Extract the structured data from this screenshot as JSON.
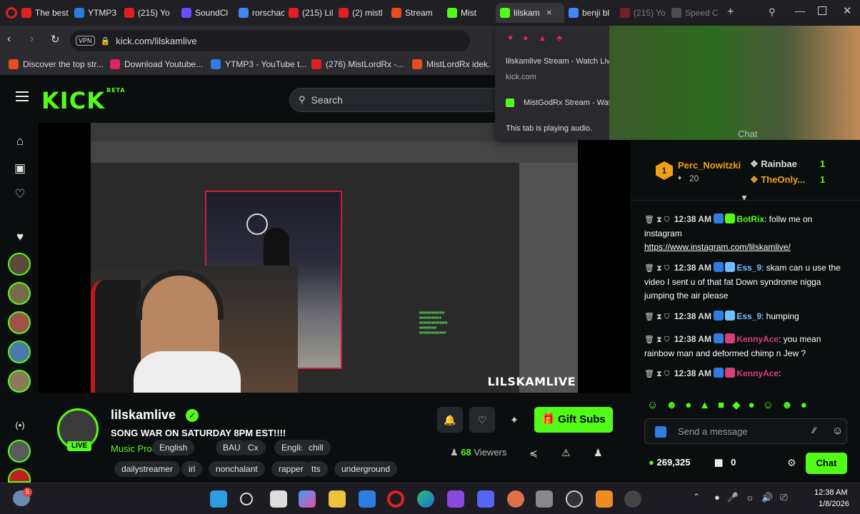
{
  "browser": {
    "tabs": [
      {
        "label": "The best",
        "color": "#e02020"
      },
      {
        "label": "YTMP3",
        "color": "#2f7de1"
      },
      {
        "label": "(215) Yo",
        "color": "#e02020"
      },
      {
        "label": "SoundCl",
        "color": "#6a4bff"
      },
      {
        "label": "rorschac",
        "color": "#4285f4"
      },
      {
        "label": "(215) Lil",
        "color": "#e02020"
      },
      {
        "label": "(2) mistl",
        "color": "#e02020"
      },
      {
        "label": "Stream",
        "color": "#e84e1b"
      },
      {
        "label": "Mist",
        "color": "#53fc18"
      },
      {
        "label": "lilskam",
        "color": "#53fc18"
      },
      {
        "label": "benji bl",
        "color": "#4285f4"
      },
      {
        "label": "(215) Yo",
        "color": "#e02020"
      },
      {
        "label": "Speed C",
        "color": "#888888"
      }
    ],
    "url": "kick.com/lilskamlive",
    "vpn_label": "VPN",
    "bookmarks": [
      {
        "label": "Discover the top str...",
        "color": "#e84e1b"
      },
      {
        "label": "Download Youtube...",
        "color": "#e0245e"
      },
      {
        "label": "YTMP3 - YouTube t...",
        "color": "#2f7de1"
      },
      {
        "label": "(276) MistLordRx -...",
        "color": "#e02020"
      },
      {
        "label": "MistLordRx idek.",
        "color": "#e84e1b"
      }
    ],
    "tab_popup": {
      "title": "lilskamlive Stream - Watch Live on Kick",
      "domain": "kick.com",
      "other_tab": "MistGodRx Stream - Watch Live on Kick",
      "audio_note": "This tab is playing audio."
    }
  },
  "kick": {
    "logo": "KICK",
    "logo_sup": "BETA",
    "search_placeholder": "Search",
    "video_watermark": "LILSKAMLIVE",
    "channel": {
      "name": "lilskamlive",
      "live_badge": "LIVE",
      "title": "SONG WAR ON SATURDAY 8PM EST!!!!",
      "category": "Music Production",
      "tags_row1": [
        "English",
        "BAU",
        "Cx",
        "English",
        "chill"
      ],
      "tags_row2": [
        "dailystreamer",
        "irl",
        "nonchalant",
        "rapper",
        "tts",
        "underground"
      ],
      "viewers": "68",
      "viewers_label": "Viewers",
      "gift_subs": "Gift Subs"
    },
    "chat": {
      "header_label": "Chat",
      "gifter_rank": "1",
      "gifter_name": "Perc_Nowitzki",
      "gifter_count": "20",
      "leaderboard": [
        {
          "name": "Rainbae",
          "count": "1"
        },
        {
          "name": "TheOnly...",
          "count": "1"
        }
      ],
      "messages": [
        {
          "time": "12:38 AM",
          "user": "BotRix",
          "color": "#53fc18",
          "text": ": follw me on instagram",
          "link": "https://www.instagram.com/lilskamlive/"
        },
        {
          "time": "12:38 AM",
          "user": "Ess_9",
          "color": "#6ec1ff",
          "text": ": skam can u use the video I sent u of that fat Down syndrome nigga jumping the air please",
          "link": ""
        },
        {
          "time": "12:38 AM",
          "user": "Ess_9",
          "color": "#6ec1ff",
          "text": ": humping",
          "link": ""
        },
        {
          "time": "12:38 AM",
          "user": "KennyAce",
          "color": "#d6407a",
          "text": ": you mean rainbow man and deformed chimp n Jew ?",
          "link": ""
        },
        {
          "time": "12:38 AM",
          "user": "KennyAce",
          "color": "#d6407a",
          "text": ":",
          "link": ""
        }
      ],
      "input_placeholder": "Send a message",
      "points": "269,325",
      "tickets": "0",
      "send_label": "Chat"
    }
  },
  "taskbar": {
    "time": "12:38 AM",
    "date": "1/8/2026",
    "weather_badge": "5"
  },
  "colors": {
    "kick_green": "#53fc18",
    "bg": "#0b0e0f"
  }
}
